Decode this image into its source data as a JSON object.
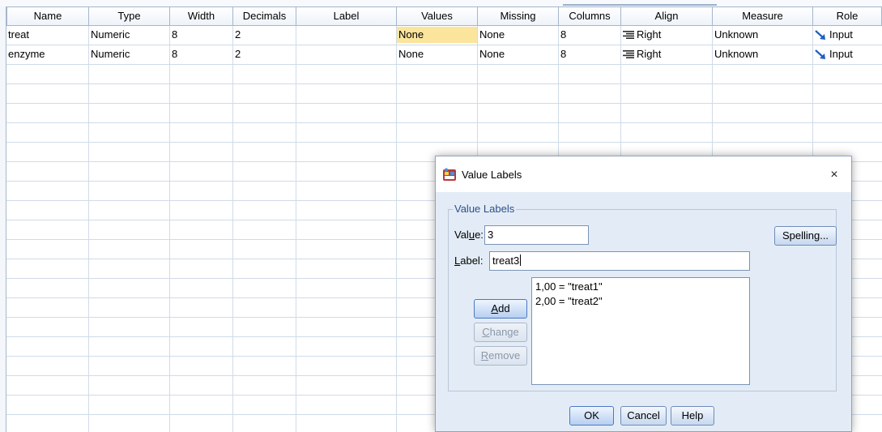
{
  "grid": {
    "columns": [
      "Name",
      "Type",
      "Width",
      "Decimals",
      "Label",
      "Values",
      "Missing",
      "Columns",
      "Align",
      "Measure",
      "Role"
    ],
    "rows": [
      {
        "name": "treat",
        "type": "Numeric",
        "width": "8",
        "decimals": "2",
        "label": "",
        "values": "None",
        "missing": "None",
        "columns": "8",
        "align": "Right",
        "measure": "Unknown",
        "role": "Input"
      },
      {
        "name": "enzyme",
        "type": "Numeric",
        "width": "8",
        "decimals": "2",
        "label": "",
        "values": "None",
        "missing": "None",
        "columns": "8",
        "align": "Right",
        "measure": "Unknown",
        "role": "Input"
      }
    ],
    "selected_cell": {
      "row": 0,
      "column": "Values"
    },
    "icons": {
      "align": "align-right-icon",
      "role": "input-arrow-icon"
    }
  },
  "dialog": {
    "title": "Value Labels",
    "title_icon": "value-labels-icon",
    "close_glyph": "×",
    "group_label": "Value Labels",
    "value_label_pre": "Val",
    "value_label_u": "u",
    "value_label_post": "e:",
    "value_input": "3",
    "label_label_u": "L",
    "label_label_post": "abel:",
    "label_input": "treat3",
    "spelling_button": "Spelling...",
    "add_button_u": "A",
    "add_button_post": "dd",
    "change_button_u": "C",
    "change_button_post": "hange",
    "remove_button_u": "R",
    "remove_button_post": "emove",
    "list_items": [
      "1,00 = \"treat1\"",
      "2,00 = \"treat2\""
    ],
    "ok_button": "OK",
    "cancel_button": "Cancel",
    "help_button": "Help"
  },
  "colors": {
    "selected_cell": "#fbe49c",
    "accent": "#2d4f8a"
  }
}
